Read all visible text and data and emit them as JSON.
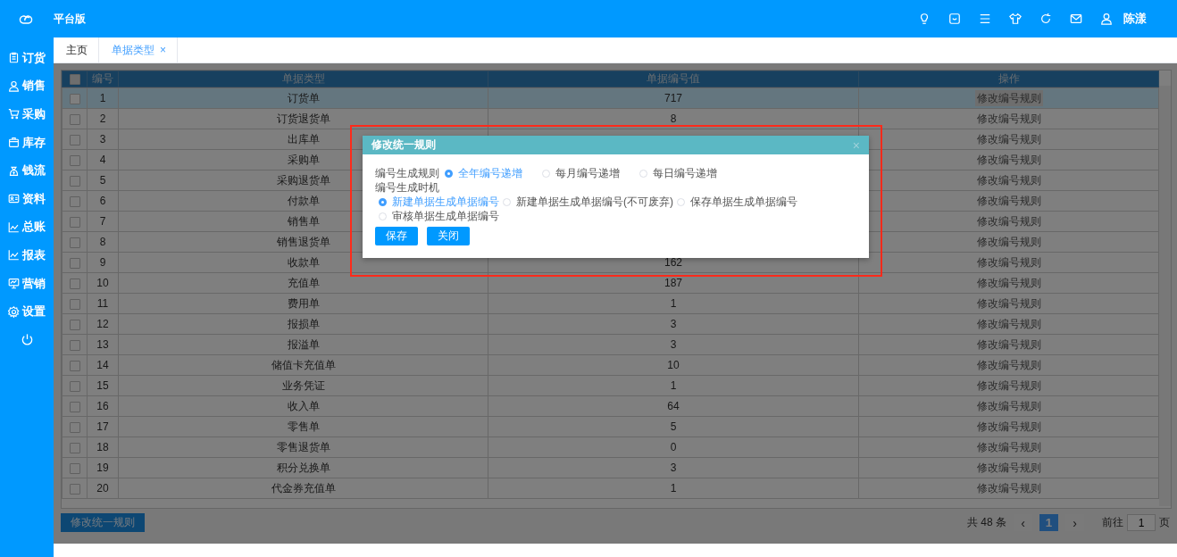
{
  "app": {
    "title": "平台版",
    "user": "陈漾"
  },
  "sidebar": {
    "items": [
      {
        "label": "订货"
      },
      {
        "label": "销售"
      },
      {
        "label": "采购"
      },
      {
        "label": "库存"
      },
      {
        "label": "钱流"
      },
      {
        "label": "资料"
      },
      {
        "label": "总账"
      },
      {
        "label": "报表"
      },
      {
        "label": "营销"
      },
      {
        "label": "设置"
      }
    ]
  },
  "tabs": [
    {
      "label": "主页",
      "selected": false
    },
    {
      "label": "单据类型",
      "selected": true,
      "close": "×"
    }
  ],
  "table": {
    "columns": [
      "编号",
      "单据类型",
      "单据编号值",
      "操作"
    ],
    "header_checked": false,
    "rows": [
      {
        "no": "1",
        "type": "订货单",
        "value": "717",
        "action": "修改编号规则",
        "checked": false,
        "selected": true
      },
      {
        "no": "2",
        "type": "订货退货单",
        "value": "8",
        "action": "修改编号规则",
        "checked": false,
        "selected": false
      },
      {
        "no": "3",
        "type": "出库单",
        "action": "修改编号规则",
        "checked": false,
        "selected": false
      },
      {
        "no": "4",
        "type": "采购单",
        "action": "修改编号规则",
        "checked": false,
        "selected": false
      },
      {
        "no": "5",
        "type": "采购退货单",
        "action": "修改编号规则",
        "checked": false,
        "selected": false
      },
      {
        "no": "6",
        "type": "付款单",
        "action": "修改编号规则",
        "checked": false,
        "selected": false
      },
      {
        "no": "7",
        "type": "销售单",
        "action": "修改编号规则",
        "checked": false,
        "selected": false
      },
      {
        "no": "8",
        "type": "销售退货单",
        "action": "修改编号规则",
        "checked": false,
        "selected": false
      },
      {
        "no": "9",
        "type": "收款单",
        "value": "162",
        "action": "修改编号规则",
        "checked": false,
        "selected": false
      },
      {
        "no": "10",
        "type": "充值单",
        "value": "187",
        "action": "修改编号规则",
        "checked": false,
        "selected": false
      },
      {
        "no": "11",
        "type": "费用单",
        "value": "1",
        "action": "修改编号规则",
        "checked": false,
        "selected": false
      },
      {
        "no": "12",
        "type": "报损单",
        "value": "3",
        "action": "修改编号规则",
        "checked": false,
        "selected": false
      },
      {
        "no": "13",
        "type": "报溢单",
        "value": "3",
        "action": "修改编号规则",
        "checked": false,
        "selected": false
      },
      {
        "no": "14",
        "type": "储值卡充值单",
        "value": "10",
        "action": "修改编号规则",
        "checked": false,
        "selected": false
      },
      {
        "no": "15",
        "type": "业务凭证",
        "value": "1",
        "action": "修改编号规则",
        "checked": false,
        "selected": false
      },
      {
        "no": "16",
        "type": "收入单",
        "value": "64",
        "action": "修改编号规则",
        "checked": false,
        "selected": false
      },
      {
        "no": "17",
        "type": "零售单",
        "value": "5",
        "action": "修改编号规则",
        "checked": false,
        "selected": false
      },
      {
        "no": "18",
        "type": "零售退货单",
        "value": "0",
        "action": "修改编号规则",
        "checked": false,
        "selected": false
      },
      {
        "no": "19",
        "type": "积分兑换单",
        "value": "3",
        "action": "修改编号规则",
        "checked": false,
        "selected": false
      },
      {
        "no": "20",
        "type": "代金券充值单",
        "value": "1",
        "action": "修改编号规则",
        "checked": false,
        "selected": false
      }
    ]
  },
  "footer": {
    "button": "修改统一规则",
    "total": "共 48 条",
    "prev": "‹",
    "page": "1",
    "next": "›",
    "goto_label": "前往",
    "goto_value": "1",
    "goto_suffix": "页"
  },
  "dialog": {
    "title": "修改统一规则",
    "close": "×",
    "rule_label": "编号生成规则",
    "rule_options": [
      {
        "label": "全年编号递增",
        "selected": true
      },
      {
        "label": "每月编号递增",
        "selected": false
      },
      {
        "label": "每日编号递增",
        "selected": false
      }
    ],
    "timing_label": "编号生成时机",
    "timing_options": [
      {
        "label": "新建单据生成单据编号",
        "selected": true
      },
      {
        "label": "新建单据生成单据编号(不可废弃)",
        "selected": false
      },
      {
        "label": "保存单据生成单据编号",
        "selected": false
      },
      {
        "label": "审核单据生成单据编号",
        "selected": false
      }
    ],
    "buttons": [
      "保存",
      "关闭"
    ]
  }
}
